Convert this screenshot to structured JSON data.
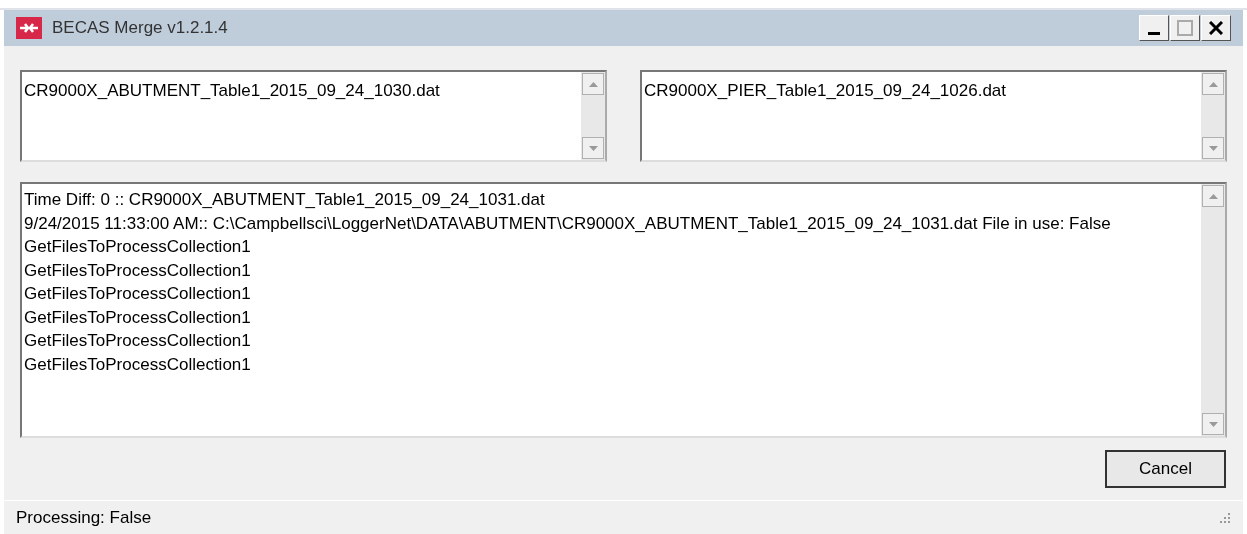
{
  "window": {
    "title": "BECAS Merge v1.2.1.4"
  },
  "file_boxes": [
    "CR9000X_ABUTMENT_Table1_2015_09_24_1030.dat",
    "CR9000X_PIER_Table1_2015_09_24_1026.dat"
  ],
  "log": [
    "Time Diff: 0 :: CR9000X_ABUTMENT_Table1_2015_09_24_1031.dat",
    "9/24/2015 11:33:00 AM:: C:\\Campbellsci\\LoggerNet\\DATA\\ABUTMENT\\CR9000X_ABUTMENT_Table1_2015_09_24_1031.dat File in use: False",
    "GetFilesToProcessCollection1",
    "GetFilesToProcessCollection1",
    "GetFilesToProcessCollection1",
    "GetFilesToProcessCollection1",
    "GetFilesToProcessCollection1",
    "GetFilesToProcessCollection1"
  ],
  "buttons": [
    "Cancel"
  ],
  "status_bar": "Processing: False"
}
